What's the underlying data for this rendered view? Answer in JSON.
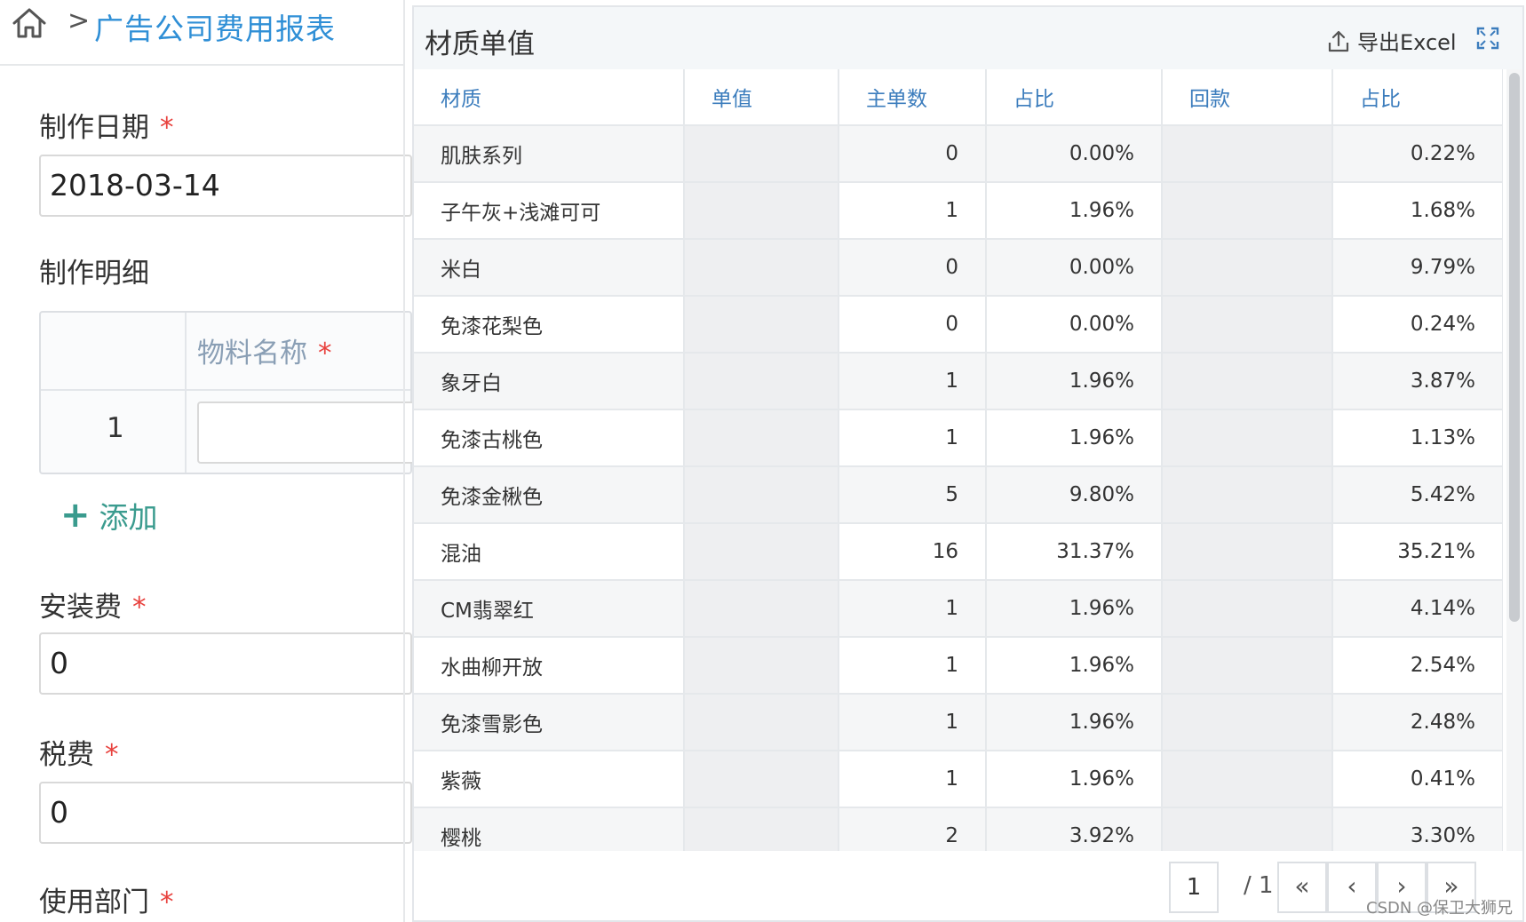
{
  "breadcrumb": {
    "separator": ">",
    "title": "广告公司费用报表"
  },
  "form": {
    "date_label": "制作日期",
    "date_value": "2018-03-14",
    "detail_label": "制作明细",
    "detail_col_label": "物料名称",
    "detail_row_index": "1",
    "add_label": "添加",
    "install_label": "安装费",
    "install_value": "0",
    "tax_label": "税费",
    "tax_value": "0",
    "dept_label": "使用部门",
    "required_mark": "*"
  },
  "report": {
    "title": "材质单值",
    "export_label": "导出Excel",
    "columns": [
      "材质",
      "单值",
      "主单数",
      "占比",
      "回款",
      "占比"
    ],
    "rows": [
      {
        "name": "肌肤系列",
        "unit": "",
        "count": "0",
        "ratio": "0.00%",
        "payback": "",
        "ratio2": "0.22%"
      },
      {
        "name": "子午灰+浅滩可可",
        "unit": "",
        "count": "1",
        "ratio": "1.96%",
        "payback": "",
        "ratio2": "1.68%"
      },
      {
        "name": "米白",
        "unit": "",
        "count": "0",
        "ratio": "0.00%",
        "payback": "",
        "ratio2": "9.79%"
      },
      {
        "name": "免漆花梨色",
        "unit": "",
        "count": "0",
        "ratio": "0.00%",
        "payback": "",
        "ratio2": "0.24%"
      },
      {
        "name": "象牙白",
        "unit": "",
        "count": "1",
        "ratio": "1.96%",
        "payback": "",
        "ratio2": "3.87%"
      },
      {
        "name": "免漆古桃色",
        "unit": "",
        "count": "1",
        "ratio": "1.96%",
        "payback": "",
        "ratio2": "1.13%"
      },
      {
        "name": "免漆金楸色",
        "unit": "",
        "count": "5",
        "ratio": "9.80%",
        "payback": "",
        "ratio2": "5.42%"
      },
      {
        "name": "混油",
        "unit": "",
        "count": "16",
        "ratio": "31.37%",
        "payback": "",
        "ratio2": "35.21%"
      },
      {
        "name": "CM翡翠红",
        "unit": "",
        "count": "1",
        "ratio": "1.96%",
        "payback": "",
        "ratio2": "4.14%"
      },
      {
        "name": "水曲柳开放",
        "unit": "",
        "count": "1",
        "ratio": "1.96%",
        "payback": "",
        "ratio2": "2.54%"
      },
      {
        "name": "免漆雪影色",
        "unit": "",
        "count": "1",
        "ratio": "1.96%",
        "payback": "",
        "ratio2": "2.48%"
      },
      {
        "name": "紫薇",
        "unit": "",
        "count": "1",
        "ratio": "1.96%",
        "payback": "",
        "ratio2": "0.41%"
      },
      {
        "name": "樱桃",
        "unit": "",
        "count": "2",
        "ratio": "3.92%",
        "payback": "",
        "ratio2": "3.30%"
      }
    ],
    "pager": {
      "current": "1",
      "total": "/ 1",
      "first": "«",
      "prev": "‹",
      "next": "›",
      "last": "»"
    }
  },
  "watermark": "CSDN @保卫大狮兄",
  "colors": {
    "link_blue": "#2f8fd6",
    "header_blue": "#3c7dbd",
    "add_green": "#3a9b8e",
    "required_red": "#e8413d"
  },
  "icons": [
    "home-icon",
    "export-icon",
    "fullscreen-icon"
  ]
}
